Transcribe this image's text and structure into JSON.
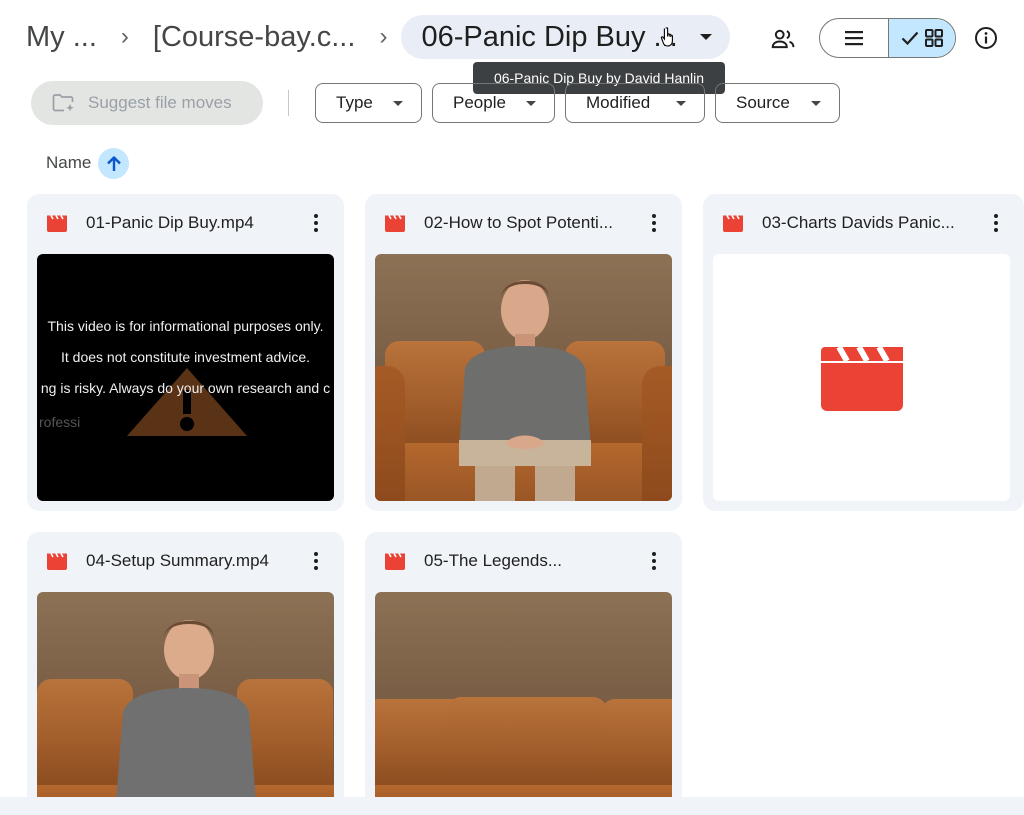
{
  "breadcrumb": {
    "items": [
      "My ...",
      "[Course-bay.c...",
      "06-Panic Dip Buy ..."
    ],
    "separator": "›"
  },
  "tooltip": {
    "text": "06-Panic Dip Buy by David Hanlin"
  },
  "toolbar": {
    "suggest_label": "Suggest file moves",
    "filters": [
      "Type",
      "People",
      "Modified",
      "Source"
    ],
    "view_mode": "grid"
  },
  "sort": {
    "label": "Name",
    "direction": "ascending"
  },
  "files": [
    {
      "name": "01-Panic Dip Buy.mp4",
      "thumbnail": "disclaimer",
      "disclaimer_lines": [
        "This video is for informational purposes only.",
        "It does not constitute investment advice.",
        "ng is risky. Always do your own research and c",
        "rofessi"
      ]
    },
    {
      "name": "02-How to Spot Potenti...",
      "thumbnail": "photo"
    },
    {
      "name": "03-Charts Davids Panic...",
      "thumbnail": "video-icon"
    },
    {
      "name": "04-Setup Summary.mp4",
      "thumbnail": "photo"
    },
    {
      "name": "05-The Legends...",
      "thumbnail": "photo"
    }
  ],
  "colors": {
    "accent": "#c2e7ff",
    "card_bg": "#f0f4f9",
    "video_icon": "#ea4335",
    "tooltip_bg": "#3c4043"
  }
}
